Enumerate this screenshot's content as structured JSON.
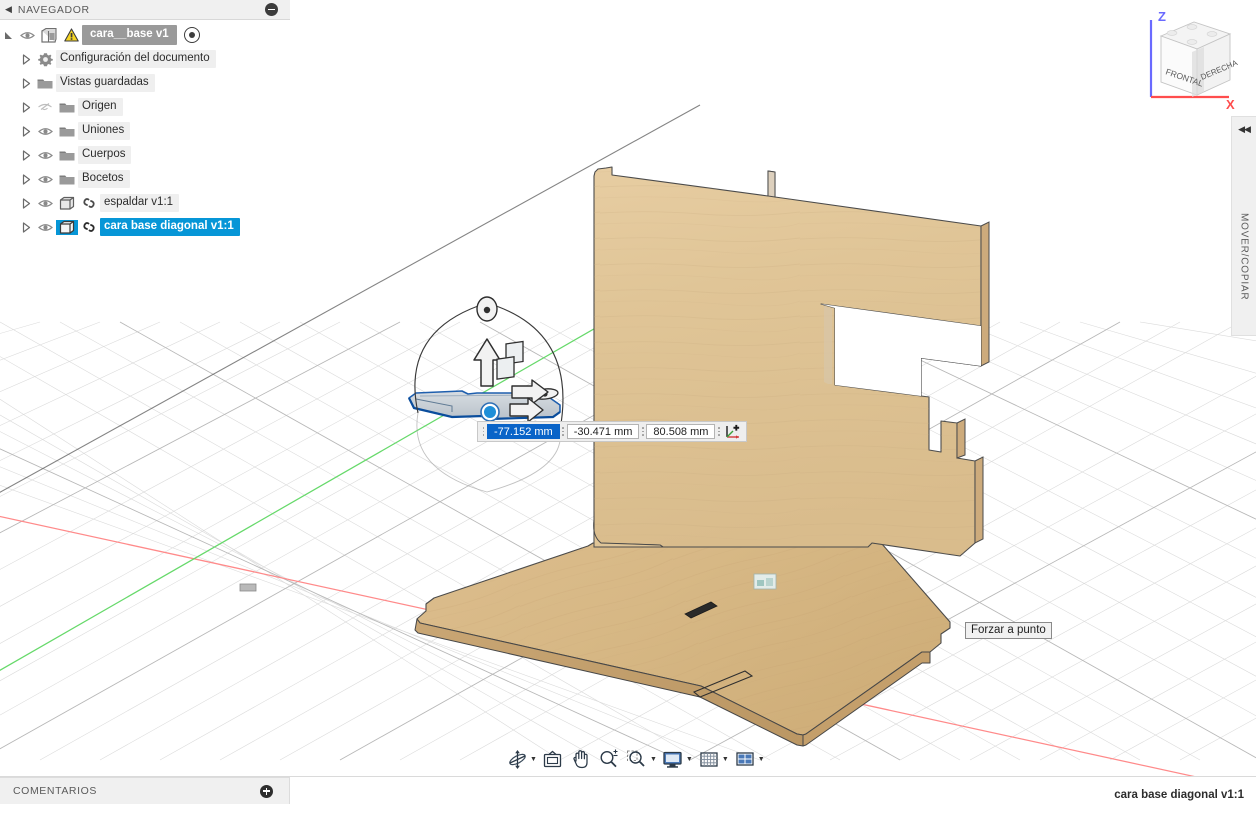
{
  "app": {
    "status_right": "cara base diagonal v1:1"
  },
  "navigator": {
    "title": "NAVEGADOR",
    "collapse_icon": "collapse-left-icon",
    "minimize_icon": "minus-circle-icon",
    "root": {
      "label": "cara__base v1",
      "has_warning": true,
      "eye_icon": "eye-icon",
      "component_icon": "component-icon",
      "warning_icon": "warning-triangle-icon",
      "activate_icon": "radio-target-icon"
    },
    "items": [
      {
        "label": "Configuración del documento",
        "icon": "gear-icon",
        "has_eye": false,
        "eye_state": "none",
        "type": "settings"
      },
      {
        "label": "Vistas guardadas",
        "icon": "folder-icon",
        "has_eye": false,
        "eye_state": "none",
        "type": "folder"
      },
      {
        "label": "Origen",
        "icon": "folder-icon",
        "has_eye": true,
        "eye_state": "hidden",
        "type": "folder"
      },
      {
        "label": "Uniones",
        "icon": "folder-icon",
        "has_eye": true,
        "eye_state": "visible",
        "type": "folder"
      },
      {
        "label": "Cuerpos",
        "icon": "folder-icon",
        "has_eye": true,
        "eye_state": "visible",
        "type": "folder"
      },
      {
        "label": "Bocetos",
        "icon": "folder-icon",
        "has_eye": true,
        "eye_state": "visible",
        "type": "folder"
      },
      {
        "label": "espaldar v1:1",
        "icon": "body-cube-icon",
        "link_icon": "link-icon",
        "has_eye": true,
        "eye_state": "visible",
        "type": "component",
        "selected": false
      },
      {
        "label": "cara base diagonal v1:1",
        "icon": "body-cube-icon",
        "link_icon": "link-icon",
        "has_eye": true,
        "eye_state": "visible",
        "type": "component",
        "selected": true
      }
    ]
  },
  "comments": {
    "title": "COMENTARIOS",
    "add_icon": "plus-circle-icon"
  },
  "move_copy_panel": {
    "label": "MOVER/COPIAR",
    "collapse_icon": "double-chevron-left-icon"
  },
  "dimensions": {
    "fields": [
      {
        "name": "x-distance",
        "value": "-77.152 mm",
        "active": true
      },
      {
        "name": "y-distance",
        "value": "-30.471 mm",
        "active": false
      },
      {
        "name": "z-distance",
        "value": "80.508 mm",
        "active": false
      }
    ],
    "triad_icon": "move-triad-icon"
  },
  "tooltip": {
    "text": "Forzar a punto"
  },
  "viewcube": {
    "front_face": "FRONTAL",
    "right_face": "DERECHA",
    "axis_z": "Z",
    "axis_x": "X",
    "axis_z_color": "#6a6aff",
    "axis_x_color": "#ff4d4d"
  },
  "bottom_toolbar": {
    "buttons": [
      {
        "name": "orbit-button",
        "icon": "orbit-icon",
        "has_dropdown": true
      },
      {
        "name": "look-at-button",
        "icon": "look-at-icon",
        "has_dropdown": false
      },
      {
        "name": "pan-button",
        "icon": "hand-pan-icon",
        "has_dropdown": false
      },
      {
        "name": "zoom-button",
        "icon": "zoom-plusminus-icon",
        "has_dropdown": false
      },
      {
        "name": "fit-button",
        "icon": "zoom-window-icon",
        "has_dropdown": true
      },
      {
        "name": "display-settings-button",
        "icon": "monitor-icon",
        "has_dropdown": true
      },
      {
        "name": "grid-snaps-button",
        "icon": "grid-icon",
        "has_dropdown": true
      },
      {
        "name": "viewports-button",
        "icon": "viewport-layout-icon",
        "has_dropdown": true
      }
    ]
  },
  "colors": {
    "accent_blue": "#0696d7",
    "selection_blue": "#0a64c8",
    "wood_light": "#e5c99b",
    "wood_mid": "#d8b887",
    "wood_dark": "#c6a473",
    "axis_x": "#ff8a8a",
    "axis_y": "#66d96a",
    "grid": "#cfcfcf",
    "panel_bg": "#f0f0f0"
  }
}
